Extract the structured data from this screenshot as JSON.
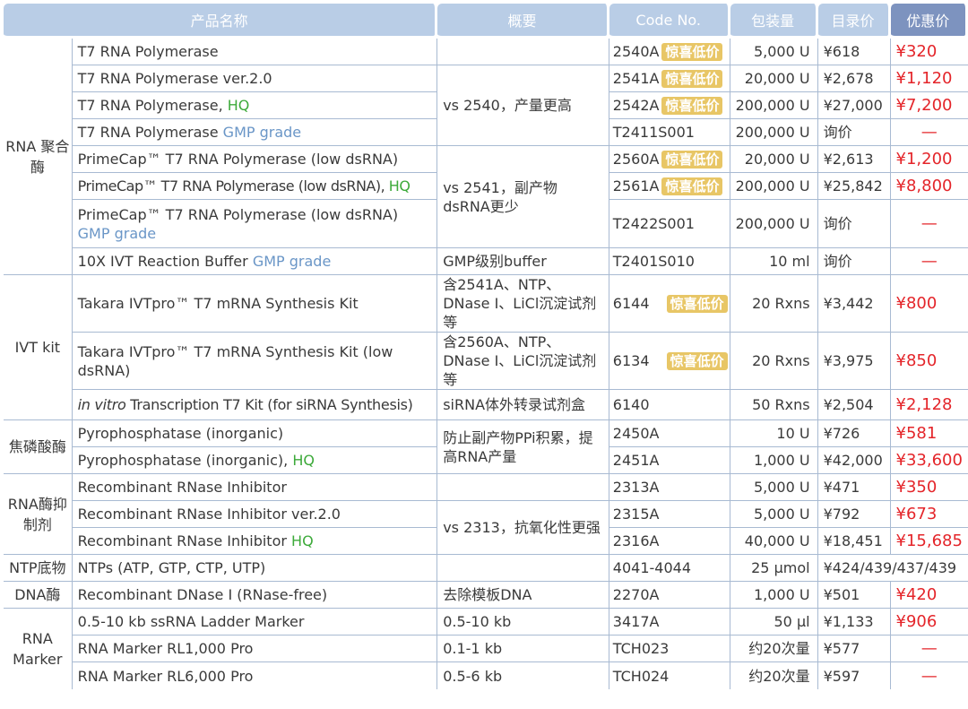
{
  "headers": {
    "product": "产品名称",
    "summary": "概要",
    "code": "Code No.",
    "pack": "包装量",
    "list_price": "目录价",
    "sale_price": "优惠价"
  },
  "badge": "惊喜低价",
  "groups": [
    {
      "name": "RNA 聚合酶",
      "rows": [
        {
          "product": "T7 RNA Polymerase",
          "summary": "",
          "code": "2540A",
          "badge": true,
          "pack": "5,000 U",
          "list": "¥618",
          "sale": "¥320"
        },
        {
          "product": "T7 RNA Polymerase ver.2.0",
          "summary": "vs 2540，产量更高",
          "code": "2541A",
          "badge": true,
          "pack": "20,000 U",
          "list": "¥2,678",
          "sale": "¥1,120"
        },
        {
          "product": "T7 RNA Polymerase,",
          "suffix": "HQ",
          "code": "2542A",
          "badge": true,
          "pack": "200,000 U",
          "list": "¥27,000",
          "sale": "¥7,200"
        },
        {
          "product": "T7 RNA Polymerase",
          "suffix": "GMP grade",
          "code": "T2411S001",
          "badge": false,
          "pack": "200,000 U",
          "list": "询价",
          "sale": "—"
        },
        {
          "product": "PrimeCap™ T7 RNA Polymerase (low dsRNA)",
          "summary": "vs 2541，副产物dsRNA更少",
          "code": "2560A",
          "badge": true,
          "pack": "20,000 U",
          "list": "¥2,613",
          "sale": "¥1,200"
        },
        {
          "product": "PrimeCap™ T7 RNA Polymerase (low dsRNA),",
          "suffix": "HQ",
          "code": "2561A",
          "badge": true,
          "pack": "200,000 U",
          "list": "¥25,842",
          "sale": "¥8,800"
        },
        {
          "product": "PrimeCap™ T7 RNA Polymerase (low dsRNA)",
          "suffix": "GMP grade",
          "code": "T2422S001",
          "badge": false,
          "pack": "200,000 U",
          "list": "询价",
          "sale": "—"
        },
        {
          "product": "10X IVT Reaction Buffer",
          "suffix": "GMP grade",
          "summary": "GMP级别buffer",
          "code": "T2401S010",
          "badge": false,
          "pack": "10 ml",
          "list": "询价",
          "sale": "—"
        }
      ]
    },
    {
      "name": "IVT kit",
      "rows": [
        {
          "product": "Takara IVTpro™ T7 mRNA Synthesis Kit",
          "summary": "含2541A、NTP、DNase I、LiCl沉淀试剂等",
          "code": "6144",
          "badge": true,
          "pack": "20 Rxns",
          "list": "¥3,442",
          "sale": "¥800"
        },
        {
          "product": "Takara IVTpro™ T7 mRNA Synthesis Kit (low dsRNA)",
          "summary": "含2560A、NTP、DNase I、LiCl沉淀试剂等",
          "code": "6134",
          "badge": true,
          "pack": "20 Rxns",
          "list": "¥3,975",
          "sale": "¥850"
        },
        {
          "product_italic": "in vitro",
          "product": "Transcription T7 Kit (for siRNA Synthesis)",
          "summary": "siRNA体外转录试剂盒",
          "code": "6140",
          "badge": false,
          "pack": "50 Rxns",
          "list": "¥2,504",
          "sale": "¥2,128"
        }
      ]
    },
    {
      "name": "焦磷酸酶",
      "rows": [
        {
          "product": "Pyrophosphatase (inorganic)",
          "summary": "防止副产物PPi积累，提高RNA产量",
          "code": "2450A",
          "badge": false,
          "pack": "10 U",
          "list": "¥726",
          "sale": "¥581"
        },
        {
          "product": "Pyrophosphatase (inorganic),",
          "suffix": "HQ",
          "code": "2451A",
          "badge": false,
          "pack": "1,000 U",
          "list": "¥42,000",
          "sale": "¥33,600"
        }
      ]
    },
    {
      "name": "RNA酶抑制剂",
      "rows": [
        {
          "product": "Recombinant RNase Inhibitor",
          "summary": "",
          "code": "2313A",
          "badge": false,
          "pack": "5,000 U",
          "list": "¥471",
          "sale": "¥350"
        },
        {
          "product": "Recombinant RNase Inhibitor ver.2.0",
          "summary": "vs 2313，抗氧化性更强",
          "code": "2315A",
          "badge": false,
          "pack": "5,000 U",
          "list": "¥792",
          "sale": "¥673"
        },
        {
          "product": "Recombinant RNase Inhibitor",
          "suffix": "HQ",
          "code": "2316A",
          "badge": false,
          "pack": "40,000 U",
          "list": "¥18,451",
          "sale": "¥15,685"
        }
      ]
    },
    {
      "name": "NTP底物",
      "rows": [
        {
          "product": "NTPs (ATP, GTP, CTP, UTP)",
          "summary": "",
          "code": "4041-4044",
          "badge": false,
          "pack": "25 μmol",
          "list": "¥424/439/437/439",
          "sale": ""
        }
      ]
    },
    {
      "name": "DNA酶",
      "rows": [
        {
          "product": "Recombinant DNase I (RNase-free)",
          "summary": "去除模板DNA",
          "code": "2270A",
          "badge": false,
          "pack": "1,000 U",
          "list": "¥501",
          "sale": "¥420"
        }
      ]
    },
    {
      "name": "RNA Marker",
      "rows": [
        {
          "product": "0.5-10 kb ssRNA Ladder Marker",
          "summary": "0.5-10 kb",
          "code": "3417A",
          "badge": false,
          "pack": "50 μl",
          "list": "¥1,133",
          "sale": "¥906"
        },
        {
          "product": "RNA Marker RL1,000 Pro",
          "summary": "0.1-1 kb",
          "code": "TCH023",
          "badge": false,
          "pack": "约20次量",
          "list": "¥577",
          "sale": "—"
        },
        {
          "product": "RNA Marker RL6,000 Pro",
          "summary": "0.5-6 kb",
          "code": "TCH024",
          "badge": false,
          "pack": "约20次量",
          "list": "¥597",
          "sale": "—"
        }
      ]
    }
  ]
}
